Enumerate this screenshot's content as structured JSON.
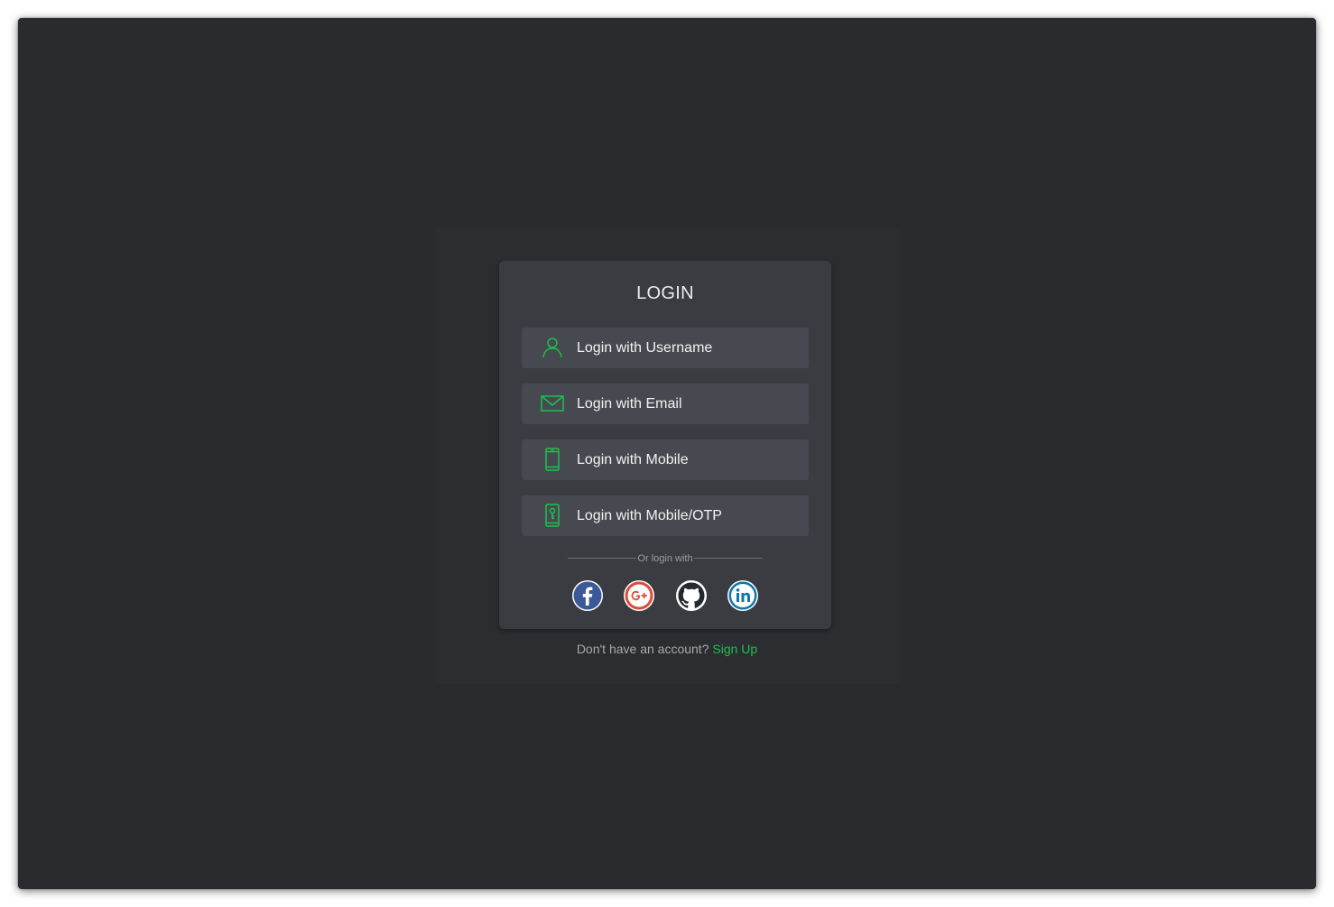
{
  "login": {
    "title": "LOGIN",
    "options": [
      {
        "label": "Login with Username",
        "icon": "user-icon"
      },
      {
        "label": "Login with Email",
        "icon": "email-icon"
      },
      {
        "label": "Login with Mobile",
        "icon": "mobile-icon"
      },
      {
        "label": "Login with Mobile/OTP",
        "icon": "mobile-otp-icon"
      }
    ],
    "divider_text": "Or login with",
    "social": [
      {
        "name": "facebook",
        "icon": "facebook-icon",
        "color": "#3b5998"
      },
      {
        "name": "google-plus",
        "icon": "google-plus-icon",
        "color": "#dd4b39"
      },
      {
        "name": "github",
        "icon": "github-icon",
        "color": "#24292e"
      },
      {
        "name": "linkedin",
        "icon": "linkedin-icon",
        "color": "#0e76a8"
      }
    ]
  },
  "footer": {
    "prompt": "Don't have an account?",
    "signup_label": "Sign Up"
  },
  "colors": {
    "accent": "#19c24e",
    "background": "#2a2b2f",
    "card": "#3a3c42",
    "option": "#474950"
  }
}
